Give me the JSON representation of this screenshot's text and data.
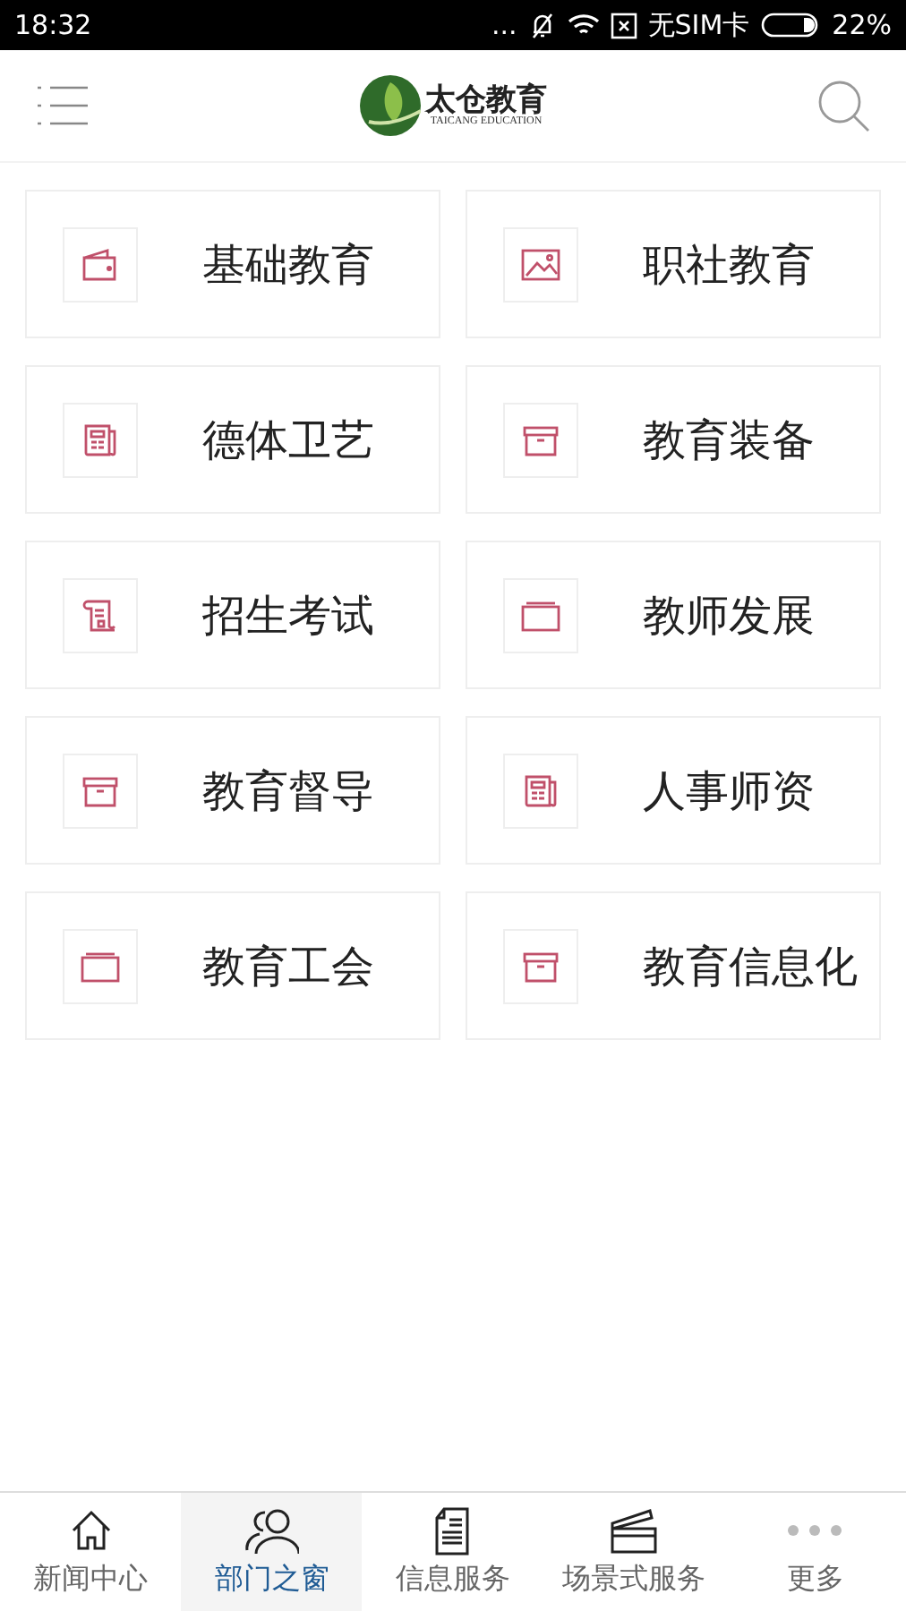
{
  "status_bar": {
    "time": "18:32",
    "dots": "...",
    "carrier": "无SIM卡",
    "battery": "22%"
  },
  "header": {
    "logo_title": "太仓教育",
    "logo_subtitle": "TAICANG EDUCATION"
  },
  "departments": [
    {
      "label": "基础教育",
      "kind": "wallet"
    },
    {
      "label": "职社教育",
      "kind": "image"
    },
    {
      "label": "德体卫艺",
      "kind": "newspaper"
    },
    {
      "label": "教育装备",
      "kind": "box"
    },
    {
      "label": "招生考试",
      "kind": "scroll"
    },
    {
      "label": "教师发展",
      "kind": "folder"
    },
    {
      "label": "教育督导",
      "kind": "box"
    },
    {
      "label": "人事师资",
      "kind": "newspaper"
    },
    {
      "label": "教育工会",
      "kind": "folder"
    },
    {
      "label": "教育信息化",
      "kind": "box"
    }
  ],
  "tabs": [
    {
      "label": "新闻中心",
      "kind": "home",
      "selected": false
    },
    {
      "label": "部门之窗",
      "kind": "people",
      "selected": true
    },
    {
      "label": "信息服务",
      "kind": "document",
      "selected": false
    },
    {
      "label": "场景式服务",
      "kind": "clapper",
      "selected": false
    },
    {
      "label": "更多",
      "kind": "more",
      "selected": false
    }
  ]
}
